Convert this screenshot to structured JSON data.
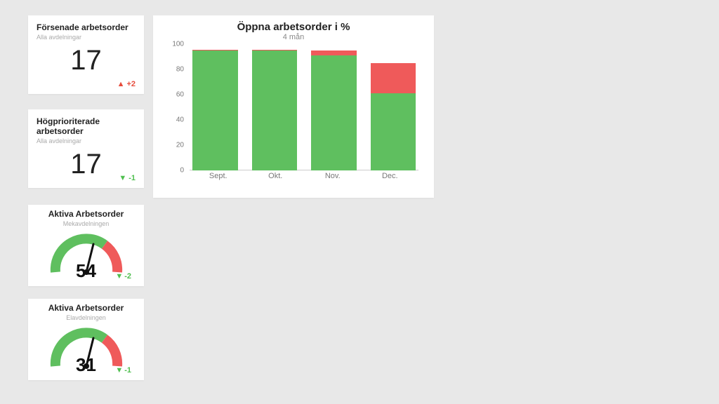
{
  "kpi": [
    {
      "title": "Försenade arbetsorder",
      "subtitle": "Alla avdelningar",
      "value": "17",
      "delta": "+2",
      "delta_dir": "up"
    },
    {
      "title": "Högprioriterade arbetsorder",
      "subtitle": "Alla avdelningar",
      "value": "17",
      "delta": "-1",
      "delta_dir": "down"
    }
  ],
  "gauge": [
    {
      "title": "Aktiva Arbetsorder",
      "subtitle": "Mekavdelningen",
      "value": "54",
      "delta": "-2",
      "gauge_value": 54,
      "gauge_max": 100,
      "green_end": 70
    },
    {
      "title": "Aktiva Arbetsorder",
      "subtitle": "Elavdelningen",
      "value": "31",
      "delta": "-1",
      "gauge_value": 55,
      "gauge_max": 100,
      "green_end": 70
    }
  ],
  "chart": {
    "title": "Öppna arbetsorder i %",
    "subtitle": "4 mån"
  },
  "chart_data": {
    "type": "bar",
    "stacked": true,
    "title": "Öppna arbetsorder i %",
    "subtitle": "4 mån",
    "xlabel": "",
    "ylabel": "",
    "ylim": [
      0,
      100
    ],
    "yticks": [
      0,
      20,
      40,
      60,
      80,
      100
    ],
    "categories": [
      "Sept.",
      "Okt.",
      "Nov.",
      "Dec."
    ],
    "series": [
      {
        "name": "green",
        "color": "#5fbf5f",
        "values": [
          98,
          98,
          94,
          63
        ]
      },
      {
        "name": "red",
        "color": "#ef5a5a",
        "values": [
          1,
          1,
          4,
          25
        ]
      }
    ]
  },
  "colors": {
    "green": "#5fbf5f",
    "red": "#ef5a5a"
  }
}
